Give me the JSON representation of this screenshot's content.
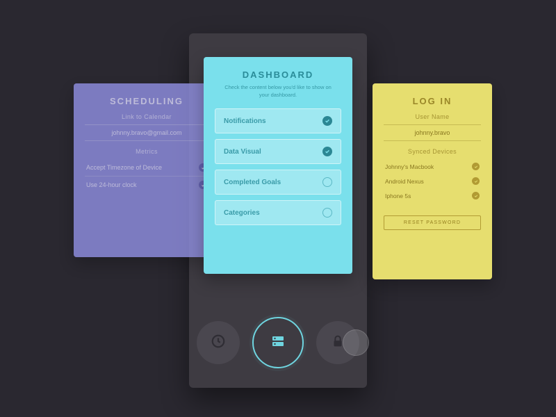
{
  "scheduling": {
    "title": "SCHEDULING",
    "link_label": "Link to Calendar",
    "email": "johnny.bravo@gmail.com",
    "metrics_label": "Metrics",
    "rows": [
      {
        "label": "Accept Timezone of Device",
        "checked": true
      },
      {
        "label": "Use 24-hour clock",
        "checked": true
      }
    ]
  },
  "dashboard": {
    "title": "DASHBOARD",
    "subtitle": "Check the content below you'd like to show on your dashboard.",
    "options": [
      {
        "label": "Notifications",
        "checked": true
      },
      {
        "label": "Data Visual",
        "checked": true
      },
      {
        "label": "Completed Goals",
        "checked": false
      },
      {
        "label": "Categories",
        "checked": false
      }
    ]
  },
  "login": {
    "title": "LOG IN",
    "username_label": "User Name",
    "username": "johnny.bravo",
    "devices_label": "Synced Devices",
    "devices": [
      {
        "label": "Johnny's Macbook",
        "checked": true
      },
      {
        "label": "Android Nexus",
        "checked": true
      },
      {
        "label": "Iphone 5s",
        "checked": true
      }
    ],
    "reset_label": "RESET PASSWORD"
  },
  "nav": {
    "items": [
      "clock",
      "dashboard",
      "lock"
    ],
    "active": "dashboard"
  }
}
